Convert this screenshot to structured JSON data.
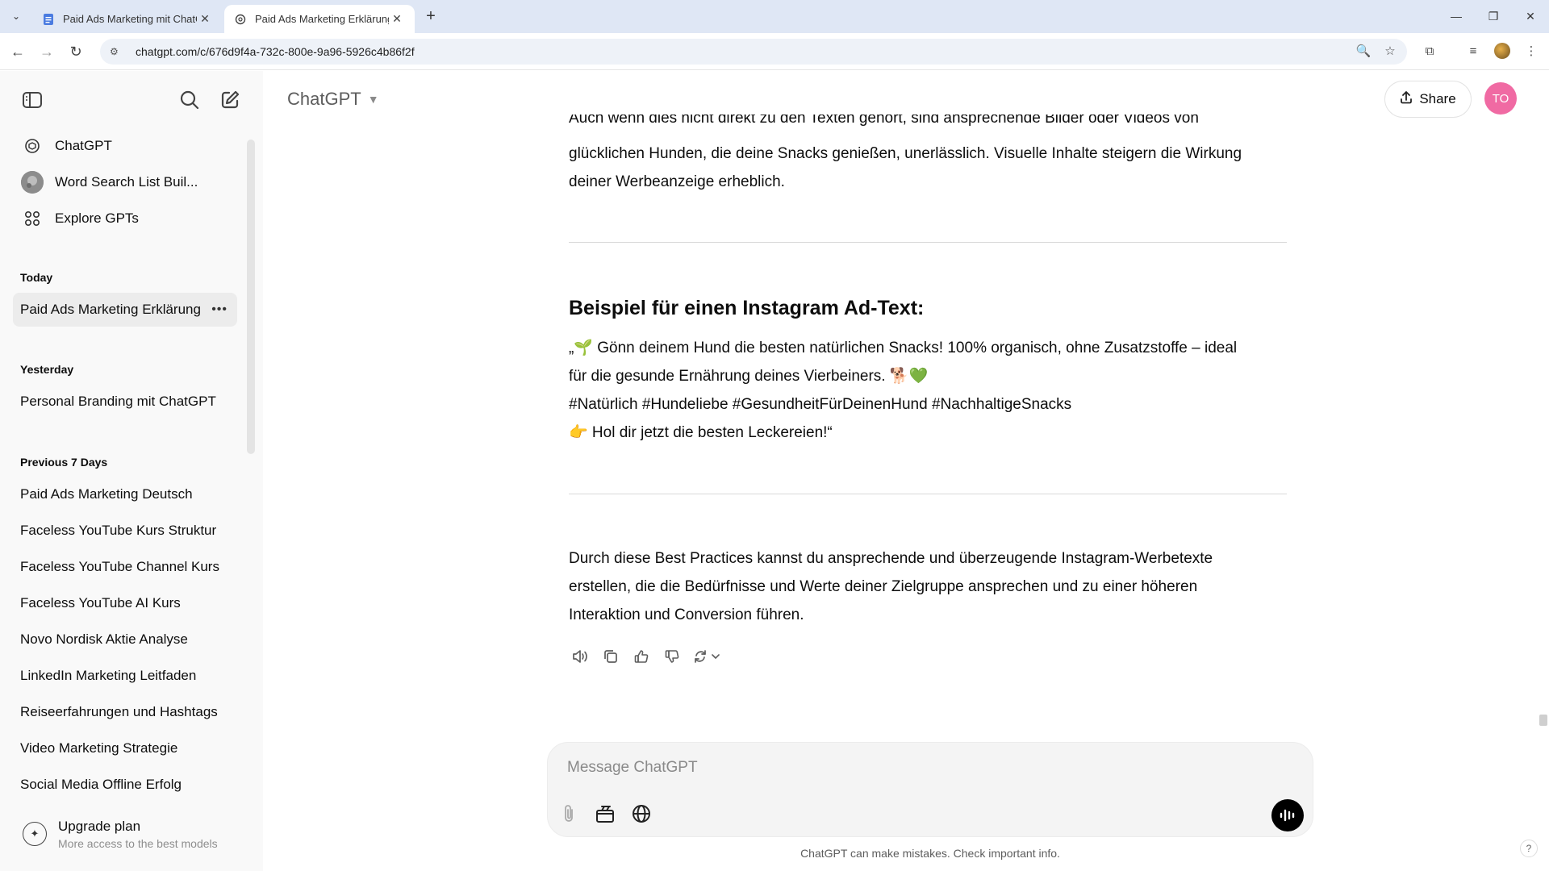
{
  "browser": {
    "tabs": [
      {
        "title": "Paid Ads Marketing mit ChatGPT",
        "active": false
      },
      {
        "title": "Paid Ads Marketing Erklärung",
        "active": true
      }
    ],
    "url": "chatgpt.com/c/676d9f4a-732c-800e-9a96-5926c4b86f2f"
  },
  "sidebar": {
    "nav": [
      {
        "label": "ChatGPT",
        "icon": "openai-logo-icon"
      },
      {
        "label": "Word Search List Buil...",
        "icon": "gpt-avatar-icon"
      },
      {
        "label": "Explore GPTs",
        "icon": "grid-icon"
      }
    ],
    "sections": [
      {
        "title": "Today",
        "items": [
          "Paid Ads Marketing Erklärung"
        ]
      },
      {
        "title": "Yesterday",
        "items": [
          "Personal Branding mit ChatGPT"
        ]
      },
      {
        "title": "Previous 7 Days",
        "items": [
          "Paid Ads Marketing Deutsch",
          "Faceless YouTube Kurs Struktur",
          "Faceless YouTube Channel Kurs",
          "Faceless YouTube AI Kurs",
          "Novo Nordisk Aktie Analyse",
          "LinkedIn Marketing Leitfaden",
          "Reiseerfahrungen und Hashtags",
          "Video Marketing Strategie",
          "Social Media Offline Erfolg"
        ]
      }
    ],
    "upgrade": {
      "title": "Upgrade plan",
      "subtitle": "More access to the best models"
    }
  },
  "header": {
    "model": "ChatGPT",
    "share_label": "Share",
    "avatar_initials": "TO"
  },
  "message": {
    "cut_line": "Auch wenn dies nicht direkt zu den Texten gehört, sind ansprechende Bilder oder Videos von",
    "para1_line2": "glücklichen Hunden, die deine Snacks genießen, unerlässlich. Visuelle Inhalte steigern die Wirkung",
    "para1_line3": "deiner Werbeanzeige erheblich.",
    "heading": "Beispiel für einen Instagram Ad-Text:",
    "ad_line1": "„🌱 Gönn deinem Hund die besten natürlichen Snacks! 100% organisch, ohne Zusatzstoffe – ideal",
    "ad_line2": "für die gesunde Ernährung deines Vierbeiners. 🐕💚",
    "ad_line3": "#Natürlich #Hundeliebe #GesundheitFürDeinenHund #NachhaltigeSnacks",
    "ad_line4": "👉 Hol dir jetzt die besten Leckereien!“",
    "closing_line1": "Durch diese Best Practices kannst du ansprechende und überzeugende Instagram-Werbetexte",
    "closing_line2": "erstellen, die die Bedürfnisse und Werte deiner Zielgruppe ansprechen und zu einer höheren",
    "closing_line3": "Interaktion und Conversion führen."
  },
  "composer": {
    "placeholder": "Message ChatGPT",
    "disclaimer": "ChatGPT can make mistakes. Check important info."
  }
}
